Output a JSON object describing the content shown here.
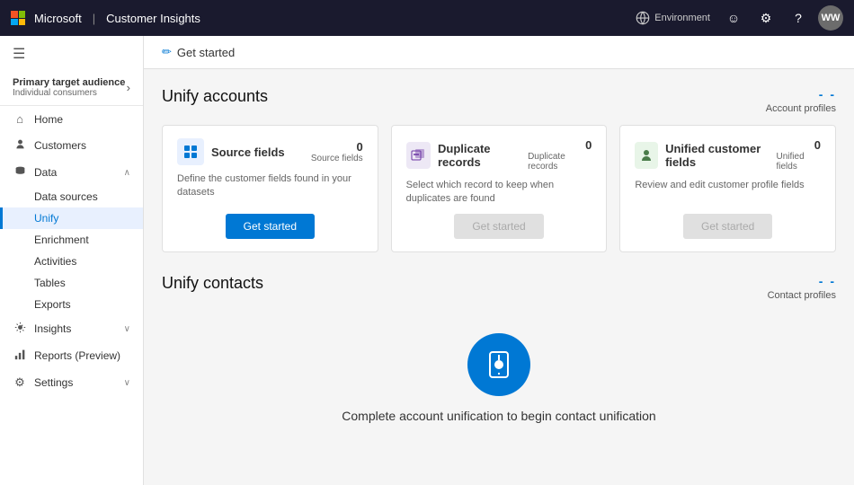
{
  "topnav": {
    "app_name": "Customer Insights",
    "environment_label": "Environment",
    "avatar_initials": "WW"
  },
  "sidebar": {
    "hamburger_icon": "☰",
    "target_audience_label": "Primary target audience",
    "target_audience_sub": "Individual consumers",
    "chevron_icon": "›",
    "items": [
      {
        "id": "home",
        "label": "Home",
        "icon": "⌂",
        "active": false
      },
      {
        "id": "customers",
        "label": "Customers",
        "icon": "👤",
        "active": false
      },
      {
        "id": "data",
        "label": "Data",
        "icon": "🗄",
        "active": false,
        "expanded": true,
        "chevron": "∧"
      },
      {
        "id": "data-sources",
        "label": "Data sources",
        "sub": true
      },
      {
        "id": "unify",
        "label": "Unify",
        "sub": true,
        "active": true
      },
      {
        "id": "enrichment",
        "label": "Enrichment",
        "sub": true
      },
      {
        "id": "activities",
        "label": "Activities",
        "sub": true
      },
      {
        "id": "tables",
        "label": "Tables",
        "sub": true
      },
      {
        "id": "exports",
        "label": "Exports",
        "sub": true
      },
      {
        "id": "insights",
        "label": "Insights",
        "icon": "💡",
        "active": false,
        "chevron": "∨"
      },
      {
        "id": "reports",
        "label": "Reports (Preview)",
        "icon": "📊",
        "active": false
      },
      {
        "id": "settings",
        "label": "Settings",
        "icon": "⚙",
        "active": false,
        "chevron": "∨"
      }
    ]
  },
  "header": {
    "icon": "✏",
    "title": "Get started"
  },
  "unify_accounts": {
    "section_title": "Unify accounts",
    "account_profiles_dash": "- -",
    "account_profiles_label": "Account profiles",
    "cards": [
      {
        "id": "source-fields",
        "title": "Source fields",
        "icon": "⊞",
        "icon_type": "blue",
        "count": "0",
        "count_label": "Source fields",
        "description": "Define the customer fields found in your datasets",
        "button_label": "Get started",
        "button_enabled": true
      },
      {
        "id": "duplicate-records",
        "title": "Duplicate records",
        "icon": "⊟",
        "icon_type": "purple",
        "count": "0",
        "count_label": "Duplicate records",
        "description": "Select which record to keep when duplicates are found",
        "button_label": "Get started",
        "button_enabled": false
      },
      {
        "id": "unified-customer-fields",
        "title": "Unified customer fields",
        "icon": "🚶",
        "icon_type": "green",
        "count": "0",
        "count_label": "Unified fields",
        "description": "Review and edit customer profile fields",
        "button_label": "Get started",
        "button_enabled": false
      }
    ]
  },
  "unify_contacts": {
    "section_title": "Unify contacts",
    "contact_profiles_dash": "- -",
    "contact_profiles_label": "Contact profiles",
    "icon": "📎",
    "message": "Complete account unification to begin contact unification"
  }
}
